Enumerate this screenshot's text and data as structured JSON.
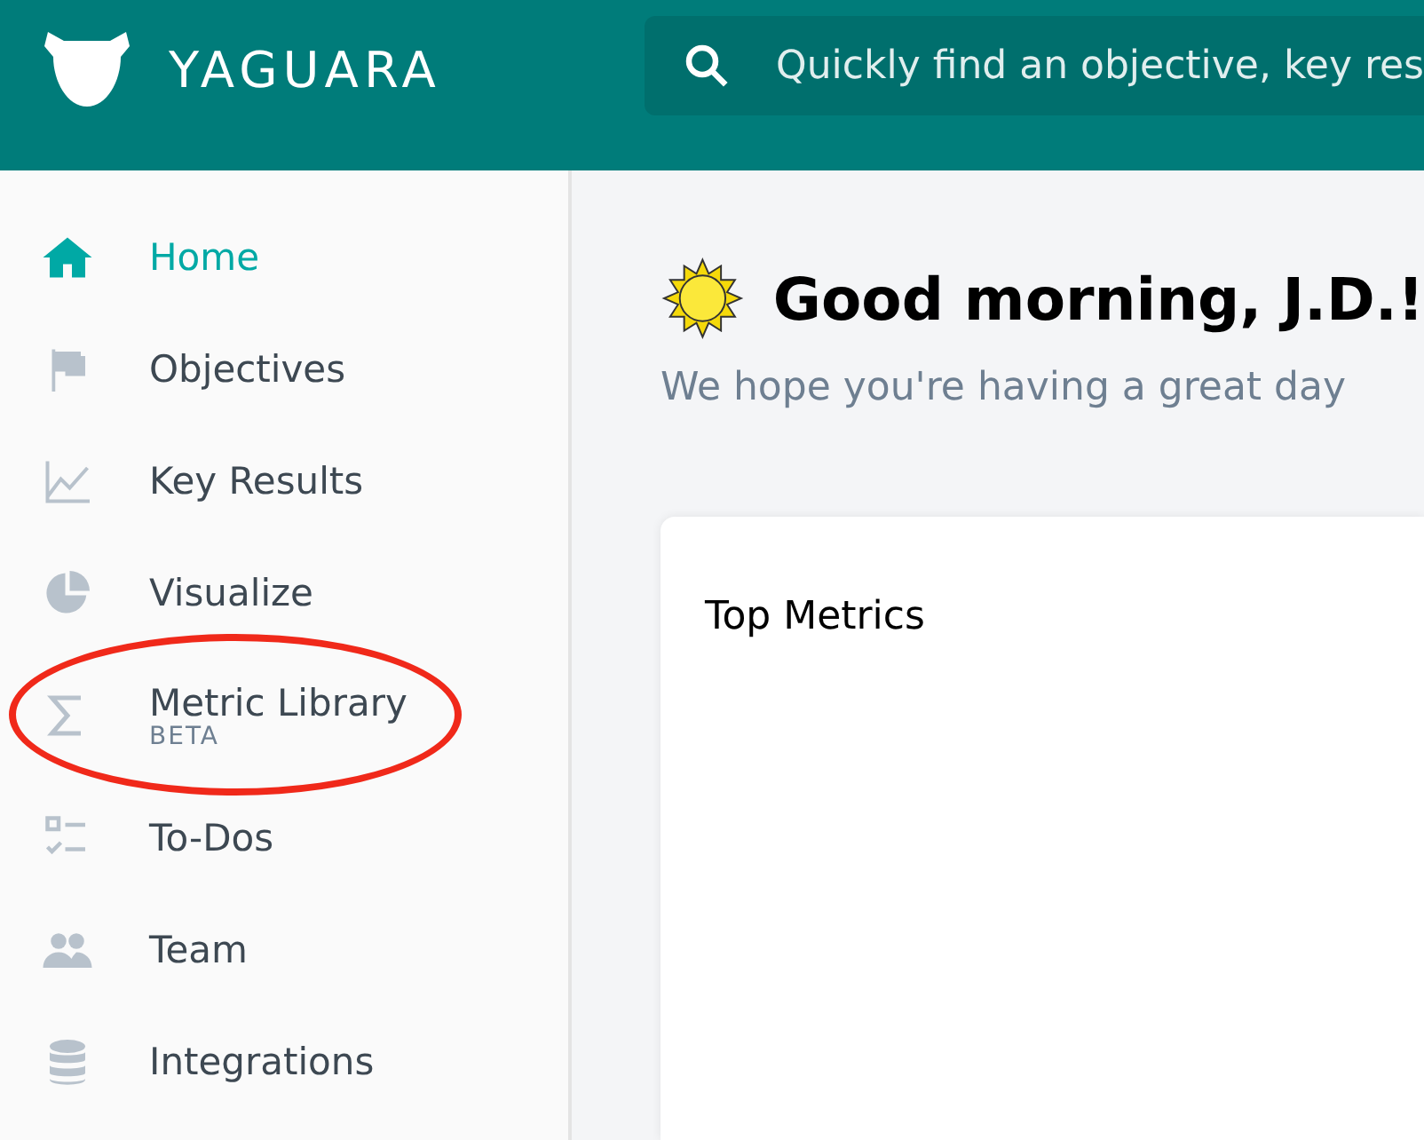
{
  "header": {
    "brand": "YAGUARA",
    "search": {
      "placeholder": "Quickly find an objective, key res"
    }
  },
  "sidebar": {
    "items": [
      {
        "label": "Home",
        "selected": true,
        "highlighted": false
      },
      {
        "label": "Objectives",
        "selected": false,
        "highlighted": false
      },
      {
        "label": "Key Results",
        "selected": false,
        "highlighted": false
      },
      {
        "label": "Visualize",
        "selected": false,
        "highlighted": false
      },
      {
        "label": "Metric Library",
        "badge": "BETA",
        "selected": false,
        "highlighted": true
      },
      {
        "label": "To-Dos",
        "selected": false,
        "highlighted": false
      },
      {
        "label": "Team",
        "selected": false,
        "highlighted": false
      },
      {
        "label": "Integrations",
        "selected": false,
        "highlighted": false
      }
    ]
  },
  "main": {
    "greeting": "Good morning, J.D.!",
    "subtitle": "We hope you're having a great day",
    "card": {
      "title": "Top Metrics"
    }
  }
}
